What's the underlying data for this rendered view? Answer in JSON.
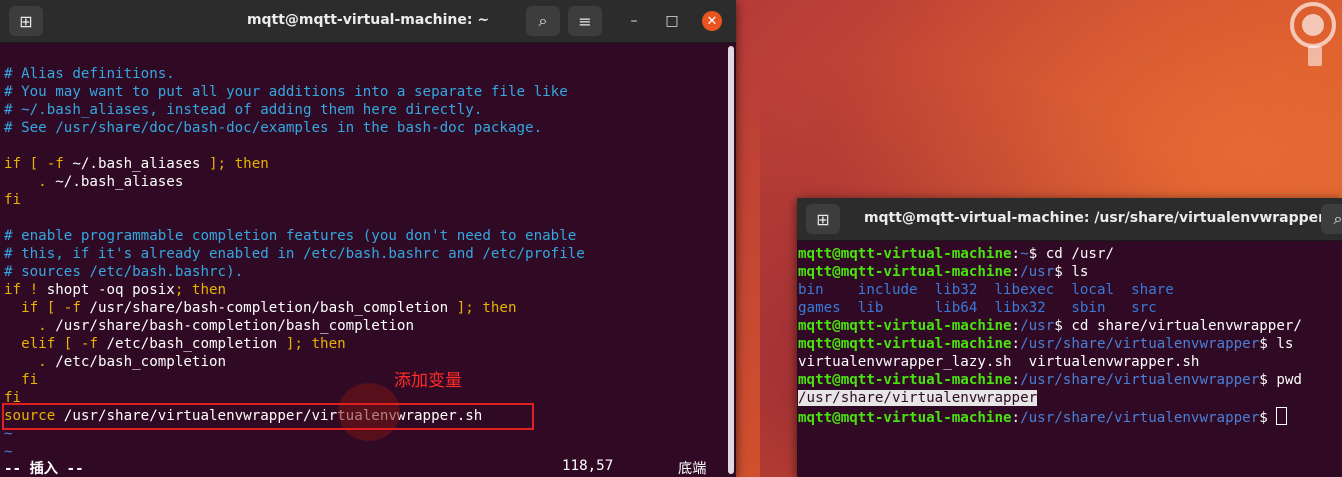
{
  "left_terminal": {
    "title": "mqtt@mqtt-virtual-machine: ~",
    "lines": [
      {
        "cls": "c-comment",
        "text": "# Alias definitions."
      },
      {
        "cls": "c-comment",
        "text": "# You may want to put all your additions into a separate file like"
      },
      {
        "cls": "c-comment",
        "text": "# ~/.bash_aliases, instead of adding them here directly."
      },
      {
        "cls": "c-comment",
        "text": "# See /usr/share/doc/bash-doc/examples in the bash-doc package."
      },
      {
        "cls": "c-white",
        "text": ""
      },
      {
        "parts": [
          {
            "cls": "c-key",
            "text": "if [ "
          },
          {
            "cls": "c-key",
            "text": "-f "
          },
          {
            "cls": "c-white",
            "text": "~/.bash_aliases "
          },
          {
            "cls": "c-key",
            "text": "]; then"
          }
        ]
      },
      {
        "parts": [
          {
            "cls": "c-key",
            "text": "    . "
          },
          {
            "cls": "c-white",
            "text": "~/.bash_aliases"
          }
        ]
      },
      {
        "cls": "c-key",
        "text": "fi"
      },
      {
        "cls": "c-white",
        "text": ""
      },
      {
        "cls": "c-comment",
        "text": "# enable programmable completion features (you don't need to enable"
      },
      {
        "cls": "c-comment",
        "text": "# this, if it's already enabled in /etc/bash.bashrc and /etc/profile"
      },
      {
        "cls": "c-comment",
        "text": "# sources /etc/bash.bashrc)."
      },
      {
        "parts": [
          {
            "cls": "c-key",
            "text": "if ! "
          },
          {
            "cls": "c-white",
            "text": "shopt -oq posix"
          },
          {
            "cls": "c-key",
            "text": "; then"
          }
        ]
      },
      {
        "parts": [
          {
            "cls": "c-key",
            "text": "  if [ "
          },
          {
            "cls": "c-key",
            "text": "-f "
          },
          {
            "cls": "c-white",
            "text": "/usr/share/bash-completion/bash_completion "
          },
          {
            "cls": "c-key",
            "text": "]; then"
          }
        ]
      },
      {
        "parts": [
          {
            "cls": "c-key",
            "text": "    . "
          },
          {
            "cls": "c-white",
            "text": "/usr/share/bash-completion/bash_completion"
          }
        ]
      },
      {
        "parts": [
          {
            "cls": "c-key",
            "text": "  elif [ "
          },
          {
            "cls": "c-key",
            "text": "-f "
          },
          {
            "cls": "c-white",
            "text": "/etc/bash_completion "
          },
          {
            "cls": "c-key",
            "text": "]; then"
          }
        ]
      },
      {
        "parts": [
          {
            "cls": "c-key",
            "text": "    . "
          },
          {
            "cls": "c-white",
            "text": "/etc/bash_completion"
          }
        ]
      },
      {
        "cls": "c-key",
        "text": "  fi"
      },
      {
        "cls": "c-key",
        "text": "fi"
      },
      {
        "parts": [
          {
            "cls": "c-cmd",
            "text": "source "
          },
          {
            "cls": "c-white",
            "text": "/usr/share/virtualenvwrapper/virtualenvwrapper.sh"
          }
        ]
      },
      {
        "cls": "c-tilde",
        "text": "~"
      },
      {
        "cls": "c-tilde",
        "text": "~"
      }
    ],
    "annotation": "添加变量",
    "status_mode": "-- 插入 --",
    "status_pos": "118,57",
    "status_loc": "底端"
  },
  "right_terminal": {
    "title": "mqtt@mqtt-virtual-machine: /usr/share/virtualenvwrapper",
    "lines": [
      {
        "parts": [
          {
            "cls": "green",
            "text": "mqtt@mqtt-virtual-machine"
          },
          {
            "cls": "c-white",
            "text": ":"
          },
          {
            "cls": "blue",
            "text": "~"
          },
          {
            "cls": "c-white",
            "text": "$ cd /usr/"
          }
        ]
      },
      {
        "parts": [
          {
            "cls": "green",
            "text": "mqtt@mqtt-virtual-machine"
          },
          {
            "cls": "c-white",
            "text": ":"
          },
          {
            "cls": "blue",
            "text": "/usr"
          },
          {
            "cls": "c-white",
            "text": "$ ls"
          }
        ]
      },
      {
        "parts": [
          {
            "cls": "dirblue",
            "text": "bin    include  lib32  libexec  local  share"
          }
        ]
      },
      {
        "parts": [
          {
            "cls": "dirblue",
            "text": "games  lib      lib64  libx32   sbin   src"
          }
        ]
      },
      {
        "parts": [
          {
            "cls": "green",
            "text": "mqtt@mqtt-virtual-machine"
          },
          {
            "cls": "c-white",
            "text": ":"
          },
          {
            "cls": "blue",
            "text": "/usr"
          },
          {
            "cls": "c-white",
            "text": "$ cd share/virtualenvwrapper/"
          }
        ]
      },
      {
        "parts": [
          {
            "cls": "green",
            "text": "mqtt@mqtt-virtual-machine"
          },
          {
            "cls": "c-white",
            "text": ":"
          },
          {
            "cls": "blue",
            "text": "/usr/share/virtualenvwrapper"
          },
          {
            "cls": "c-white",
            "text": "$ ls"
          }
        ]
      },
      {
        "parts": [
          {
            "cls": "c-white",
            "text": "virtualenvwrapper_lazy.sh  virtualenvwrapper.sh"
          }
        ]
      },
      {
        "parts": [
          {
            "cls": "green",
            "text": "mqtt@mqtt-virtual-machine"
          },
          {
            "cls": "c-white",
            "text": ":"
          },
          {
            "cls": "blue",
            "text": "/usr/share/virtualenvwrapper"
          },
          {
            "cls": "c-white",
            "text": "$ pwd"
          }
        ]
      },
      {
        "parts": [
          {
            "cls": "sel",
            "text": "/usr/share/virtualenvwrapper"
          }
        ]
      },
      {
        "parts": [
          {
            "cls": "green",
            "text": "mqtt@mqtt-virtual-machine"
          },
          {
            "cls": "c-white",
            "text": ":"
          },
          {
            "cls": "blue",
            "text": "/usr/share/virtualenvwrapper"
          },
          {
            "cls": "c-white",
            "text": "$ "
          }
        ],
        "caret": true
      }
    ]
  }
}
